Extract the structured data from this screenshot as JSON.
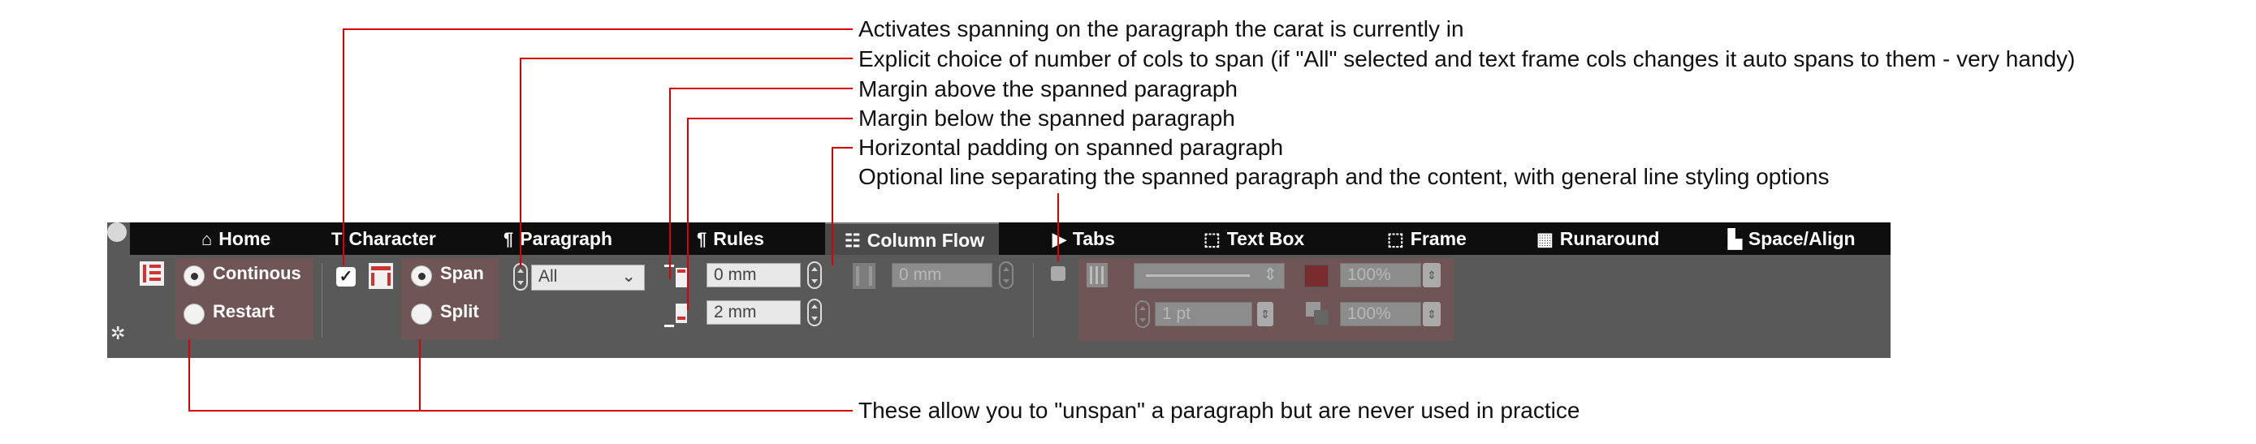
{
  "annotations": [
    "Activates spanning on the paragraph the carat is currently in",
    "Explicit choice of number of cols to span (if \"All\" selected and text frame cols changes it auto spans to them - very handy)",
    "Margin above the spanned paragraph",
    "Margin below the spanned paragraph",
    "Horizontal padding on spanned paragraph",
    "Optional line separating the spanned paragraph and the content, with general line styling options",
    "These allow you to \"unspan\" a paragraph but are never used in practice"
  ],
  "tabs": [
    {
      "label": "Home",
      "icon": "home-icon",
      "glyph": "⌂"
    },
    {
      "label": "Character",
      "icon": "character-icon",
      "glyph": "T"
    },
    {
      "label": "Paragraph",
      "icon": "pilcrow-icon",
      "glyph": "¶"
    },
    {
      "label": "Rules",
      "icon": "rules-icon",
      "glyph": "¶"
    },
    {
      "label": "Column Flow",
      "icon": "column-flow-icon",
      "glyph": "☷"
    },
    {
      "label": "Tabs",
      "icon": "tabs-icon",
      "glyph": "▶"
    },
    {
      "label": "Text Box",
      "icon": "text-box-icon",
      "glyph": "⬚"
    },
    {
      "label": "Frame",
      "icon": "frame-icon",
      "glyph": "⬚"
    },
    {
      "label": "Runaround",
      "icon": "runaround-icon",
      "glyph": "▦"
    },
    {
      "label": "Space/Align",
      "icon": "space-align-icon",
      "glyph": "▙"
    }
  ],
  "active_tab": "Column Flow",
  "column_flow": {
    "continous_label": "Continous",
    "restart_label": "Restart",
    "span_label": "Span",
    "split_label": "Split",
    "span_checked": true,
    "span_radio_selected": "Span",
    "flow_radio_selected": "Continous",
    "columns_value": "All",
    "margin_above": "0 mm",
    "margin_below": "2 mm",
    "horizontal_padding": "0 mm",
    "line_weight": "1 pt",
    "line_opacity_1": "100%",
    "line_opacity_2": "100%"
  },
  "colors": {
    "leader": "#d80000",
    "toolbar_bg": "#595959",
    "tabbar_bg": "#0e0e0e",
    "highlight": "#6f5555"
  }
}
